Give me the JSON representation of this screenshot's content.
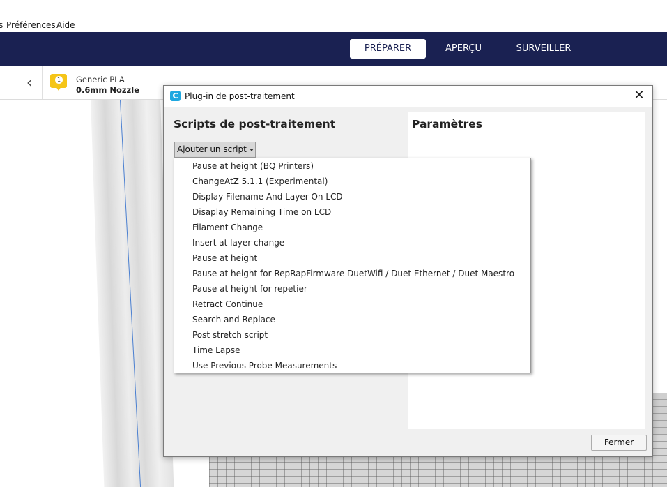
{
  "menubar": {
    "partial_item": "s",
    "preferences": "Préférences",
    "help": "Aide"
  },
  "stages": {
    "prepare": "PRÉPARER",
    "preview": "APERÇU",
    "monitor": "SURVEILLER"
  },
  "toolbar": {
    "back_icon": "chevron-left-icon",
    "extruder_number": "1",
    "material_name": "Generic PLA",
    "nozzle": "0.6mm Nozzle"
  },
  "dialog": {
    "title": "Plug-in de post-traitement",
    "left_heading": "Scripts de post-traitement",
    "right_heading": "Paramètres",
    "add_script_label": "Ajouter un script",
    "close_button_label": "Fermer",
    "close_icon": "close-icon"
  },
  "scripts_menu": [
    "Pause at height (BQ Printers)",
    "ChangeAtZ 5.1.1 (Experimental)",
    "Display Filename And Layer On LCD",
    "Disaplay Remaining Time on LCD",
    "Filament Change",
    "Insert at layer change",
    "Pause at height",
    "Pause at height for RepRapFirmware DuetWifi / Duet Ethernet / Duet Maestro",
    "Pause at height for repetier",
    "Retract Continue",
    "Search and Replace",
    "Post stretch script",
    "Time Lapse",
    "Use Previous Probe Measurements"
  ],
  "colors": {
    "stage_bar": "#1a2152",
    "accent": "#1ea7e0",
    "extruder_badge": "#f5c518"
  }
}
